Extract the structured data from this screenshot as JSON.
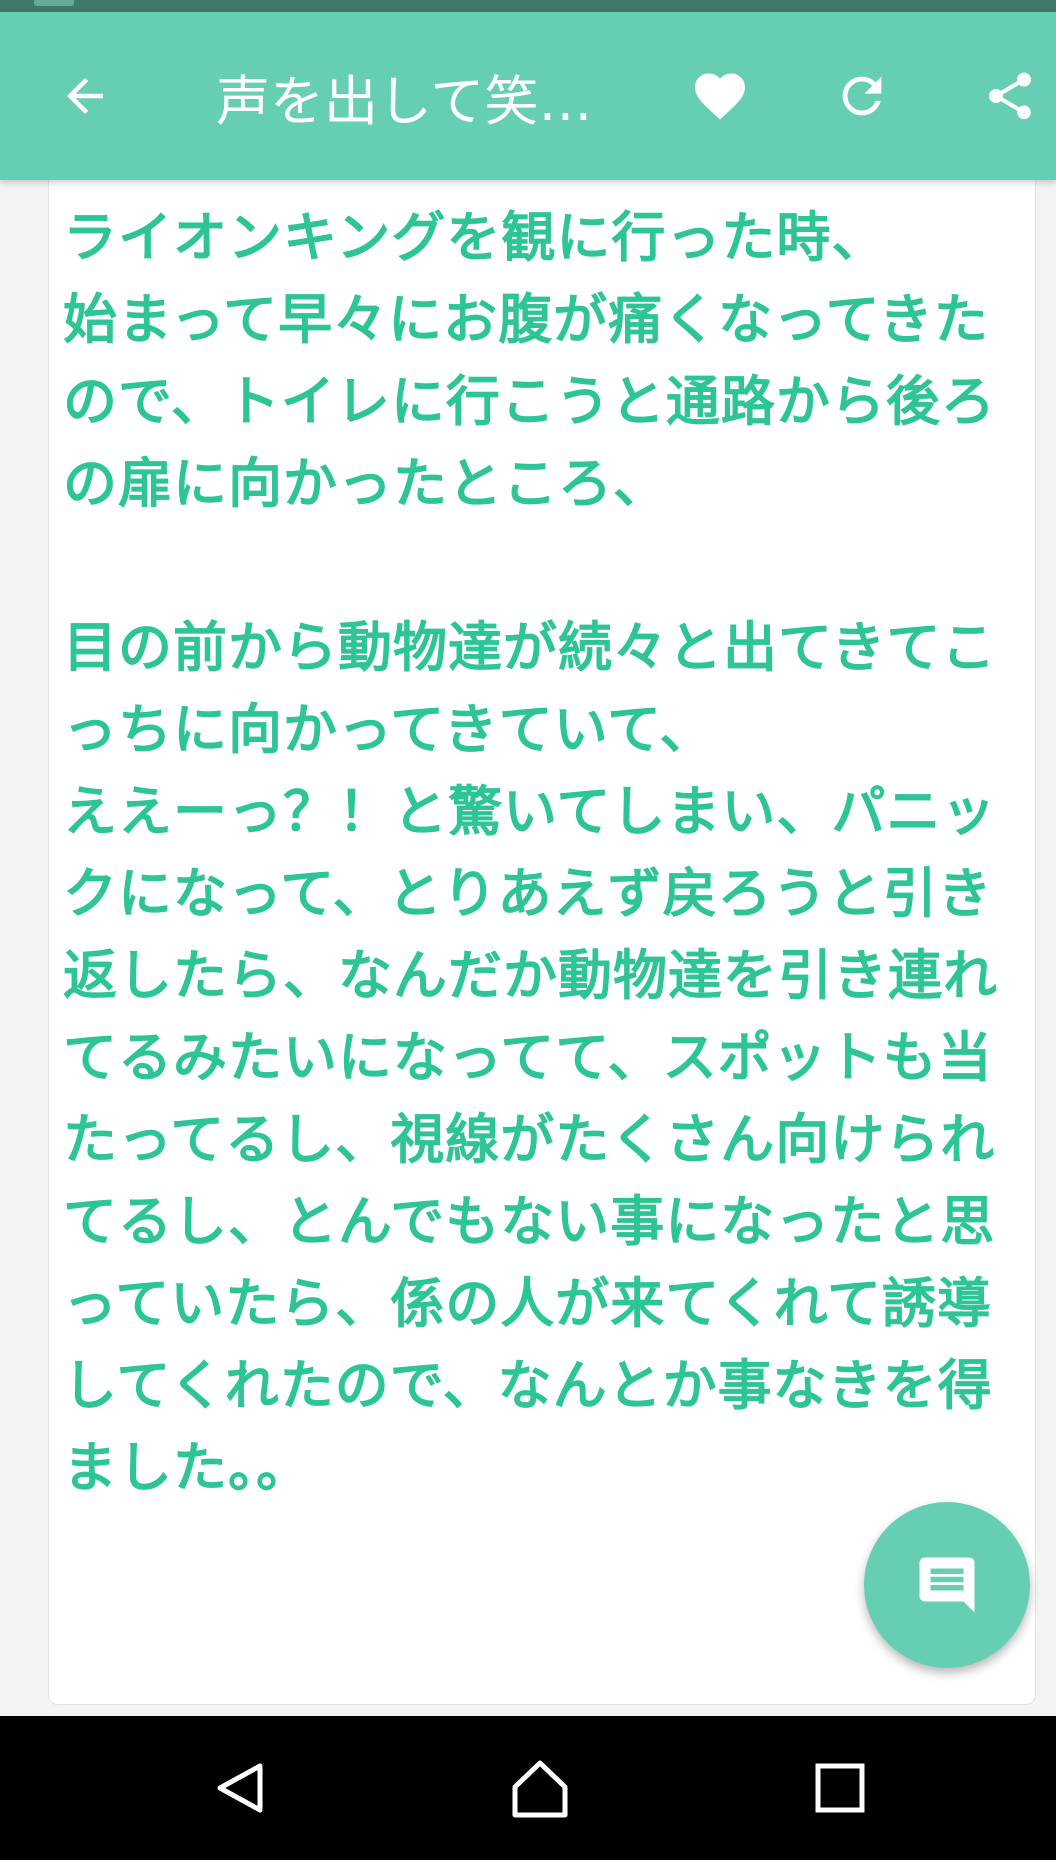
{
  "app_bar": {
    "title": "声を出して笑…",
    "back_icon": "arrow-left-icon",
    "favorite_icon": "heart-icon",
    "reload_icon": "refresh-icon",
    "share_icon": "share-icon",
    "color": "#66cfb3"
  },
  "post": {
    "text": "ライオンキングを観に行った時、\n始まって早々にお腹が痛くなってきたので、トイレに行こうと通路から後ろの扉に向かったところ、\n\n目の前から動物達が続々と出てきてこっちに向かってきていて、\nええーっ？！と驚いてしまい、パニックになって、とりあえず戻ろうと引き返したら、なんだか動物達を引き連れてるみたいになってて、スポットも当たってるし、視線がたくさん向けられてるし、とんでもない事になったと思っていたら、係の人が来てくれて誘導してくれたので、なんとか事なきを得ました。。",
    "text_color": "#2dc496"
  },
  "fab": {
    "icon": "comment-icon"
  },
  "nav_bar": {
    "back_icon": "nav-back-icon",
    "home_icon": "nav-home-icon",
    "recent_icon": "nav-recent-icon"
  }
}
